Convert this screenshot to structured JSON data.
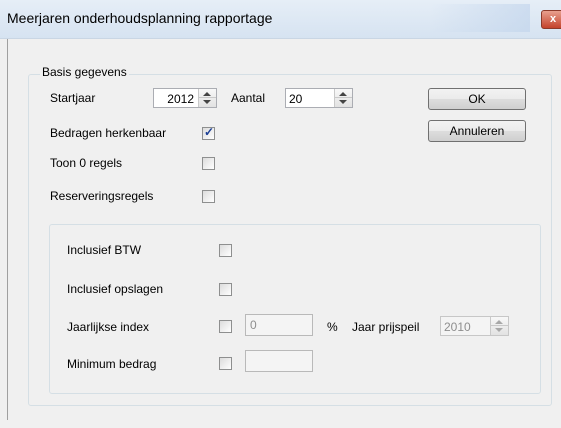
{
  "window": {
    "title": "Meerjaren onderhoudsplanning rapportage",
    "close_glyph": "x"
  },
  "group": {
    "legend": "Basis gegevens",
    "startjaar": {
      "label": "Startjaar",
      "value": "2012"
    },
    "aantal": {
      "label": "Aantal",
      "value": "20"
    },
    "bedragen_herkenbaar": {
      "label": "Bedragen herkenbaar",
      "checked": true
    },
    "toon_0_regels": {
      "label": "Toon 0 regels",
      "checked": false
    },
    "reserveringsregels": {
      "label": "Reserveringsregels",
      "checked": false
    }
  },
  "buttons": {
    "ok": "OK",
    "annuleren": "Annuleren"
  },
  "options": {
    "inclusief_btw": {
      "label": "Inclusief BTW",
      "checked": false
    },
    "inclusief_opslagen": {
      "label": "Inclusief opslagen",
      "checked": false
    },
    "jaarlijkse_index": {
      "label": "Jaarlijkse index",
      "checked": false,
      "value": "0",
      "unit": "%"
    },
    "jaar_prijspeil": {
      "label": "Jaar prijspeil",
      "value": "2010"
    },
    "minimum_bedrag": {
      "label": "Minimum bedrag",
      "checked": false,
      "value": ""
    }
  },
  "colors": {
    "check_mark": "#1c3f94",
    "disabled_text": "#8e8e8e"
  }
}
